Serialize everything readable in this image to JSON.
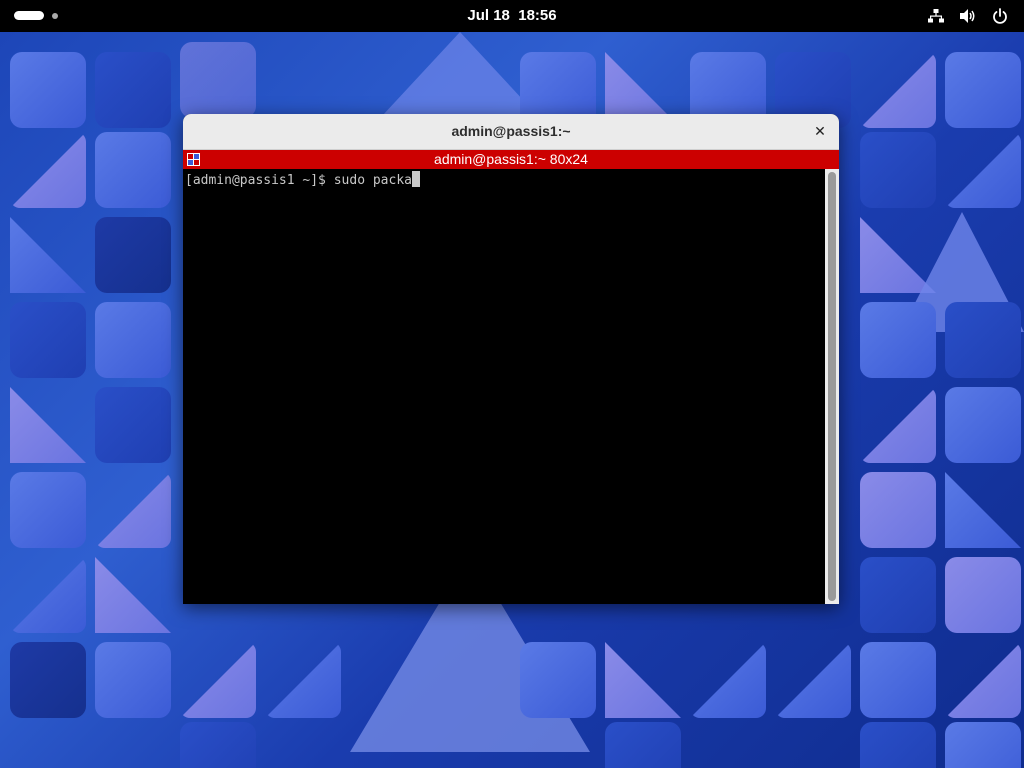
{
  "topbar": {
    "clock_date": "Jul 18",
    "clock_time": "18:56",
    "icons": [
      "workspace-indicator-icon",
      "network-icon",
      "volume-icon",
      "power-icon"
    ]
  },
  "terminal": {
    "window_title": "admin@passis1:~",
    "tab_title": "admin@passis1:~ 80x24",
    "prompt": "[admin@passis1 ~]$ ",
    "command": "sudo packa",
    "tab_color": "#cc0000"
  },
  "colors": {
    "wallpaper": "#1d46b8",
    "topbar": "#000000",
    "headerbar": "#ebebeb"
  }
}
